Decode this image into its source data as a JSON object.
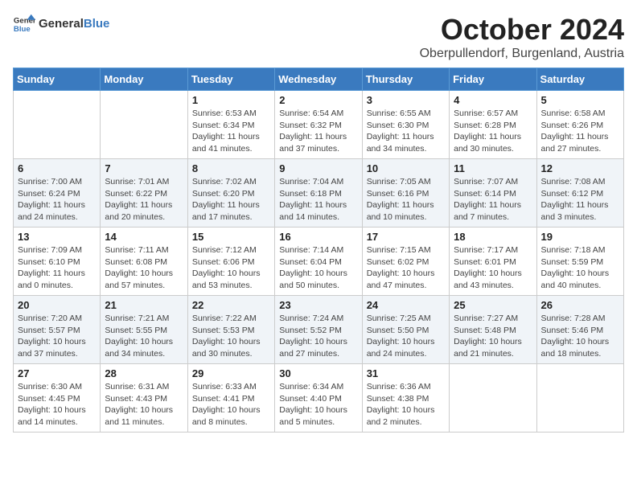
{
  "header": {
    "logo_general": "General",
    "logo_blue": "Blue",
    "month": "October 2024",
    "location": "Oberpullendorf, Burgenland, Austria"
  },
  "weekdays": [
    "Sunday",
    "Monday",
    "Tuesday",
    "Wednesday",
    "Thursday",
    "Friday",
    "Saturday"
  ],
  "weeks": [
    [
      {
        "day": "",
        "info": ""
      },
      {
        "day": "",
        "info": ""
      },
      {
        "day": "1",
        "info": "Sunrise: 6:53 AM\nSunset: 6:34 PM\nDaylight: 11 hours and 41 minutes."
      },
      {
        "day": "2",
        "info": "Sunrise: 6:54 AM\nSunset: 6:32 PM\nDaylight: 11 hours and 37 minutes."
      },
      {
        "day": "3",
        "info": "Sunrise: 6:55 AM\nSunset: 6:30 PM\nDaylight: 11 hours and 34 minutes."
      },
      {
        "day": "4",
        "info": "Sunrise: 6:57 AM\nSunset: 6:28 PM\nDaylight: 11 hours and 30 minutes."
      },
      {
        "day": "5",
        "info": "Sunrise: 6:58 AM\nSunset: 6:26 PM\nDaylight: 11 hours and 27 minutes."
      }
    ],
    [
      {
        "day": "6",
        "info": "Sunrise: 7:00 AM\nSunset: 6:24 PM\nDaylight: 11 hours and 24 minutes."
      },
      {
        "day": "7",
        "info": "Sunrise: 7:01 AM\nSunset: 6:22 PM\nDaylight: 11 hours and 20 minutes."
      },
      {
        "day": "8",
        "info": "Sunrise: 7:02 AM\nSunset: 6:20 PM\nDaylight: 11 hours and 17 minutes."
      },
      {
        "day": "9",
        "info": "Sunrise: 7:04 AM\nSunset: 6:18 PM\nDaylight: 11 hours and 14 minutes."
      },
      {
        "day": "10",
        "info": "Sunrise: 7:05 AM\nSunset: 6:16 PM\nDaylight: 11 hours and 10 minutes."
      },
      {
        "day": "11",
        "info": "Sunrise: 7:07 AM\nSunset: 6:14 PM\nDaylight: 11 hours and 7 minutes."
      },
      {
        "day": "12",
        "info": "Sunrise: 7:08 AM\nSunset: 6:12 PM\nDaylight: 11 hours and 3 minutes."
      }
    ],
    [
      {
        "day": "13",
        "info": "Sunrise: 7:09 AM\nSunset: 6:10 PM\nDaylight: 11 hours and 0 minutes."
      },
      {
        "day": "14",
        "info": "Sunrise: 7:11 AM\nSunset: 6:08 PM\nDaylight: 10 hours and 57 minutes."
      },
      {
        "day": "15",
        "info": "Sunrise: 7:12 AM\nSunset: 6:06 PM\nDaylight: 10 hours and 53 minutes."
      },
      {
        "day": "16",
        "info": "Sunrise: 7:14 AM\nSunset: 6:04 PM\nDaylight: 10 hours and 50 minutes."
      },
      {
        "day": "17",
        "info": "Sunrise: 7:15 AM\nSunset: 6:02 PM\nDaylight: 10 hours and 47 minutes."
      },
      {
        "day": "18",
        "info": "Sunrise: 7:17 AM\nSunset: 6:01 PM\nDaylight: 10 hours and 43 minutes."
      },
      {
        "day": "19",
        "info": "Sunrise: 7:18 AM\nSunset: 5:59 PM\nDaylight: 10 hours and 40 minutes."
      }
    ],
    [
      {
        "day": "20",
        "info": "Sunrise: 7:20 AM\nSunset: 5:57 PM\nDaylight: 10 hours and 37 minutes."
      },
      {
        "day": "21",
        "info": "Sunrise: 7:21 AM\nSunset: 5:55 PM\nDaylight: 10 hours and 34 minutes."
      },
      {
        "day": "22",
        "info": "Sunrise: 7:22 AM\nSunset: 5:53 PM\nDaylight: 10 hours and 30 minutes."
      },
      {
        "day": "23",
        "info": "Sunrise: 7:24 AM\nSunset: 5:52 PM\nDaylight: 10 hours and 27 minutes."
      },
      {
        "day": "24",
        "info": "Sunrise: 7:25 AM\nSunset: 5:50 PM\nDaylight: 10 hours and 24 minutes."
      },
      {
        "day": "25",
        "info": "Sunrise: 7:27 AM\nSunset: 5:48 PM\nDaylight: 10 hours and 21 minutes."
      },
      {
        "day": "26",
        "info": "Sunrise: 7:28 AM\nSunset: 5:46 PM\nDaylight: 10 hours and 18 minutes."
      }
    ],
    [
      {
        "day": "27",
        "info": "Sunrise: 6:30 AM\nSunset: 4:45 PM\nDaylight: 10 hours and 14 minutes."
      },
      {
        "day": "28",
        "info": "Sunrise: 6:31 AM\nSunset: 4:43 PM\nDaylight: 10 hours and 11 minutes."
      },
      {
        "day": "29",
        "info": "Sunrise: 6:33 AM\nSunset: 4:41 PM\nDaylight: 10 hours and 8 minutes."
      },
      {
        "day": "30",
        "info": "Sunrise: 6:34 AM\nSunset: 4:40 PM\nDaylight: 10 hours and 5 minutes."
      },
      {
        "day": "31",
        "info": "Sunrise: 6:36 AM\nSunset: 4:38 PM\nDaylight: 10 hours and 2 minutes."
      },
      {
        "day": "",
        "info": ""
      },
      {
        "day": "",
        "info": ""
      }
    ]
  ]
}
